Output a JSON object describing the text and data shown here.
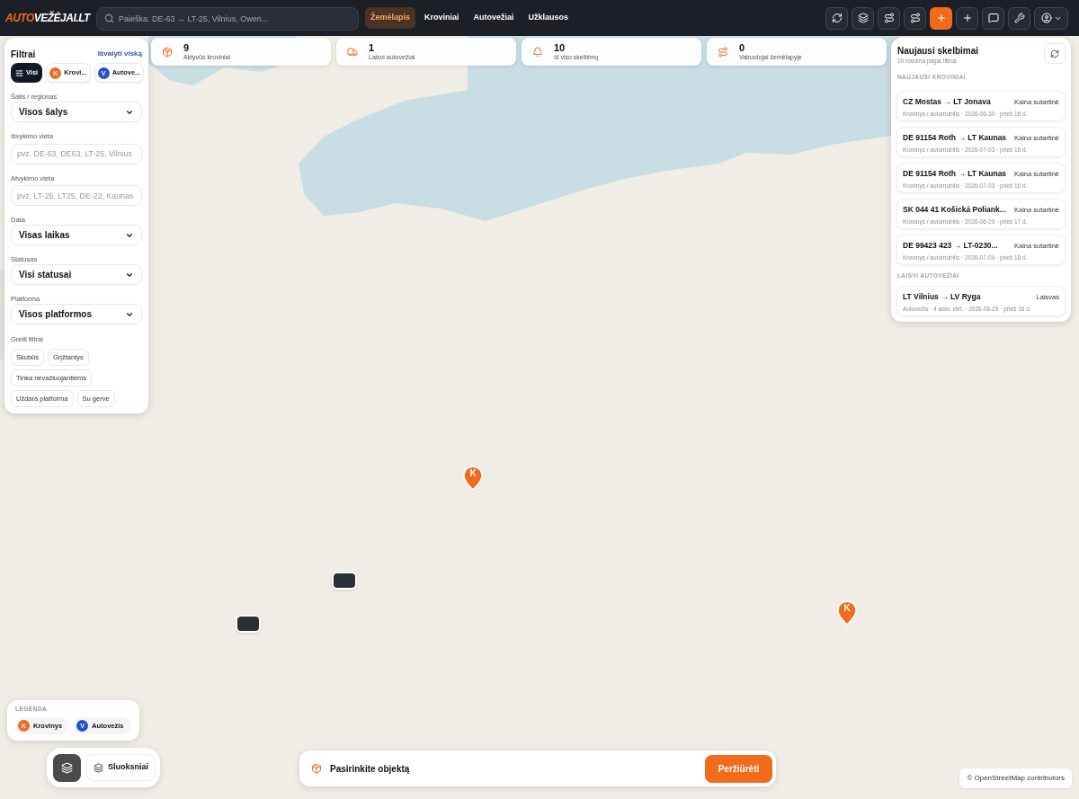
{
  "header": {
    "logo": {
      "accent": "AUTO",
      "rest": "VEŽĖJAI.LT"
    },
    "search": {
      "placeholder": "Paieška: DE-63 → LT-25, Vilnius, Owen..."
    },
    "nav": [
      {
        "label": "Žemėlapis",
        "selected": true
      },
      {
        "label": "Kroviniai",
        "selected": false
      },
      {
        "label": "Autovežiai",
        "selected": false
      },
      {
        "label": "Užklausos",
        "selected": false
      }
    ]
  },
  "stats": [
    {
      "value": "9",
      "label": "Aktyvūs kroviniai"
    },
    {
      "value": "1",
      "label": "Laisvi autovežiai"
    },
    {
      "value": "10",
      "label": "Iš viso skelbimų"
    },
    {
      "value": "0",
      "label": "Vairuotojai žemėlapyje"
    }
  ],
  "filters": {
    "title": "Filtrai",
    "clear": "Išvalyti viską",
    "types": [
      {
        "label": "Visi",
        "selected": true
      },
      {
        "label": "Krovi...",
        "badge": "K",
        "color": "#f26a1b",
        "selected": false
      },
      {
        "label": "Autove...",
        "badge": "V",
        "color": "#2451c9",
        "selected": false
      }
    ],
    "fields": [
      {
        "kind": "select",
        "label": "Šalis / regionas",
        "value": "Visos šalys"
      },
      {
        "kind": "input",
        "label": "Išvykimo vieta",
        "placeholder": "pvz. DE-63, DE63, LT-25, Vilnius"
      },
      {
        "kind": "input",
        "label": "Atvykimo vieta",
        "placeholder": "pvz. LT-25, LT25, DE-22, Kaunas"
      },
      {
        "kind": "select",
        "label": "Data",
        "value": "Visas laikas"
      },
      {
        "kind": "select",
        "label": "Statusas",
        "value": "Visi statusai"
      },
      {
        "kind": "select",
        "label": "Platforma",
        "value": "Visos platformos"
      }
    ],
    "quick_title": "Greiti filtrai",
    "quick": [
      {
        "label": "Skubūs",
        "selected": false
      },
      {
        "label": "Grįžtantys",
        "selected": false
      },
      {
        "label": "Tinka nevažiuojantiems",
        "selected": false
      },
      {
        "label": "Uždara platforma",
        "selected": false
      },
      {
        "label": "Su gerve",
        "selected": false
      }
    ]
  },
  "latest": {
    "title": "Naujausi skelbimai",
    "subtitle": "10 rodoma pagal filtrus",
    "sections": [
      {
        "title": "NAUJAUSI KROVINIAI",
        "items": [
          {
            "route": "CZ Mostas → LT Jonava",
            "price": "Kaina sutartinė",
            "meta": "Krovinys / automobilis · 2026-06-30 · prieš 16 d."
          },
          {
            "route": "DE 91154 Roth → LT Kaunas",
            "price": "Kaina sutartinė",
            "meta": "Krovinys / automobilis · 2026-07-03 · prieš 16 d."
          },
          {
            "route": "DE 91154 Roth → LT Kaunas",
            "price": "Kaina sutartinė",
            "meta": "Krovinys / automobilis · 2026-07-03 · prieš 16 d."
          },
          {
            "route": "SK 044 41 Košická Poliank...",
            "price": "Kaina sutartinė",
            "meta": "Krovinys / automobilis · 2026-06-29 · prieš 17 d."
          },
          {
            "route": "DE 99423 423 → LT-0230...",
            "price": "Kaina sutartinė",
            "meta": "Krovinys / automobilis · 2026-07-09 · prieš 18 d."
          }
        ]
      },
      {
        "title": "LAISVI AUTOVEŽIAI",
        "items": [
          {
            "route": "LT Vilnius → LV Ryga",
            "price": "Laisvas",
            "meta": "Autovežis · 4 laisv. viet. · 2026-06-29 · prieš 16 d."
          }
        ]
      }
    ]
  },
  "map": {
    "markers": [
      {
        "kind": "pin",
        "label": "K"
      },
      {
        "kind": "pin",
        "label": "K"
      },
      {
        "kind": "cluster"
      },
      {
        "kind": "cluster"
      }
    ]
  },
  "legend": {
    "title": "LEGENDA",
    "items": [
      {
        "badge": "K",
        "label": "Krovinys",
        "color": "#f26a1b"
      },
      {
        "badge": "V",
        "label": "Autovežis",
        "color": "#2451c9"
      }
    ]
  },
  "layers": {
    "label": "Sluoksniai"
  },
  "selection_bar": {
    "text": "Pasirinkite objektą",
    "button": "Peržiūrėti"
  },
  "attribution": "© OpenStreetMap contributors"
}
